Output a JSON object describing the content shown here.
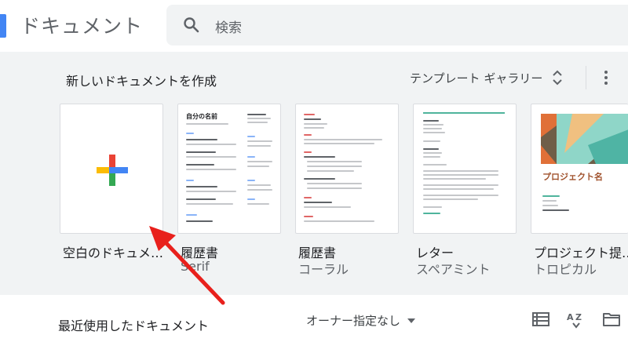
{
  "header": {
    "app_title": "ドキュメント",
    "search_placeholder": "検索"
  },
  "gallery": {
    "new_doc_title": "新しいドキュメントを作成",
    "gallery_label": "テンプレート ギャラリー",
    "templates": [
      {
        "name": "空白のドキュメ…",
        "subtitle": ""
      },
      {
        "name": "履歴書",
        "subtitle": "Serif"
      },
      {
        "name": "履歴書",
        "subtitle": "コーラル"
      },
      {
        "name": "レター",
        "subtitle": "スペアミント"
      },
      {
        "name": "プロジェクト提…",
        "subtitle": "トロピカル"
      }
    ],
    "thumb_resume_serif_heading": "自分の名前",
    "thumb_project_heading": "プロジェクト名"
  },
  "recent": {
    "title": "最近使用したドキュメント",
    "owner_filter": "オーナー指定なし"
  },
  "icons": {
    "search": "search-icon",
    "sort_toggle": "unfold-more-icon",
    "more": "more-vert-icon",
    "list_view": "list-view-icon",
    "sort_az": "sort-az-icon",
    "folder": "folder-icon",
    "dropdown": "dropdown-arrow-icon"
  },
  "colors": {
    "plus_blue": "#4285f4",
    "plus_red": "#ea4335",
    "plus_yellow": "#fbbc04",
    "plus_green": "#34a853",
    "arrow_red": "#e8201c"
  }
}
